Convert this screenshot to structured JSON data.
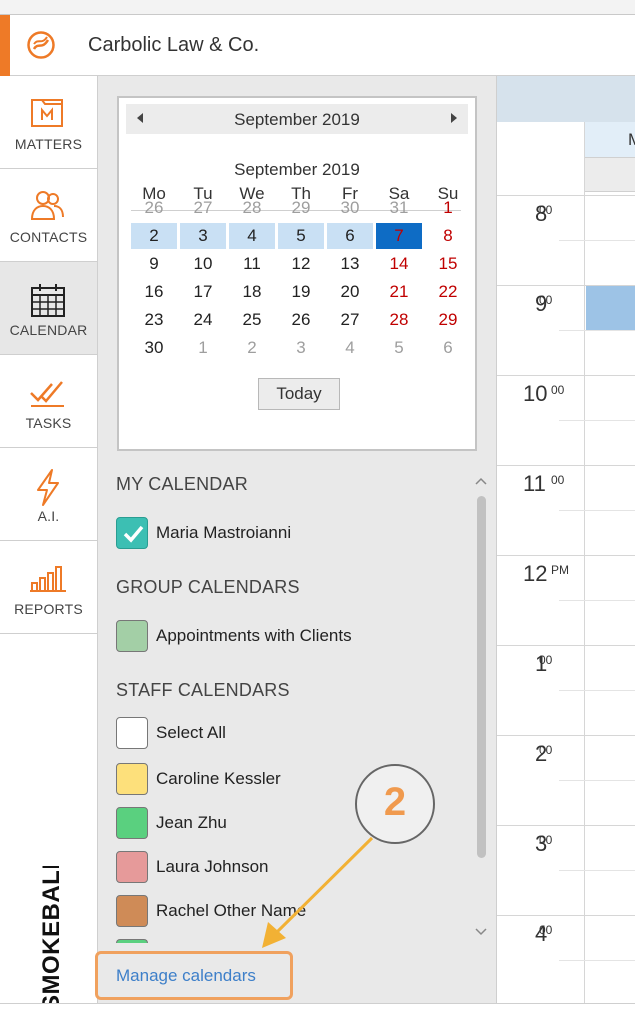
{
  "app": {
    "firm_name": "Carbolic Law & Co.",
    "brand": "SMOKEBALL",
    "accent_color": "#ee7a27"
  },
  "nav": {
    "items": [
      {
        "label": "MATTERS",
        "icon": "matters-icon"
      },
      {
        "label": "CONTACTS",
        "icon": "contacts-icon"
      },
      {
        "label": "CALENDAR",
        "icon": "calendar-icon",
        "active": true
      },
      {
        "label": "TASKS",
        "icon": "tasks-icon"
      },
      {
        "label": "A.I.",
        "icon": "lightning-icon"
      },
      {
        "label": "REPORTS",
        "icon": "reports-icon"
      }
    ]
  },
  "mini_calendar": {
    "header": "September 2019",
    "subheader": "September 2019",
    "weekdays": [
      "Mo",
      "Tu",
      "We",
      "Th",
      "Fr",
      "Sa",
      "Su"
    ],
    "weeks": [
      [
        "26",
        "27",
        "28",
        "29",
        "30",
        "31",
        "1"
      ],
      [
        "2",
        "3",
        "4",
        "5",
        "6",
        "7",
        "8"
      ],
      [
        "9",
        "10",
        "11",
        "12",
        "13",
        "14",
        "15"
      ],
      [
        "16",
        "17",
        "18",
        "19",
        "20",
        "21",
        "22"
      ],
      [
        "23",
        "24",
        "25",
        "26",
        "27",
        "28",
        "29"
      ],
      [
        "30",
        "1",
        "2",
        "3",
        "4",
        "5",
        "6"
      ]
    ],
    "selected_day": "7",
    "today_button": "Today"
  },
  "sections": {
    "my_calendar": "MY CALENDAR",
    "group_calendars": "GROUP CALENDARS",
    "staff_calendars": "STAFF CALENDARS"
  },
  "my_calendar_items": [
    {
      "name": "Maria Mastroianni",
      "color": "#3cbfb3",
      "checked": true
    }
  ],
  "group_calendar_items": [
    {
      "name": "Appointments with Clients",
      "color": "#a3cfa6"
    }
  ],
  "staff_calendar_items": [
    {
      "name": "Select All",
      "color": "#ffffff"
    },
    {
      "name": "Caroline Kessler",
      "color": "#fde07b"
    },
    {
      "name": "Jean Zhu",
      "color": "#5ad07f"
    },
    {
      "name": "Laura Johnson",
      "color": "#e69a9a"
    },
    {
      "name": "Rachel Other Name",
      "color": "#cf8b57"
    }
  ],
  "manage_link": "Manage calendars",
  "step_marker": "2",
  "day_view": {
    "day_header_char": "M",
    "hours": [
      {
        "num": "8",
        "suffix": "00"
      },
      {
        "num": "9",
        "suffix": "00"
      },
      {
        "num": "10",
        "suffix": "00"
      },
      {
        "num": "11",
        "suffix": "00"
      },
      {
        "num": "12",
        "suffix": "PM"
      },
      {
        "num": "1",
        "suffix": "00"
      },
      {
        "num": "2",
        "suffix": "00"
      },
      {
        "num": "3",
        "suffix": "00"
      },
      {
        "num": "4",
        "suffix": "00"
      }
    ]
  }
}
